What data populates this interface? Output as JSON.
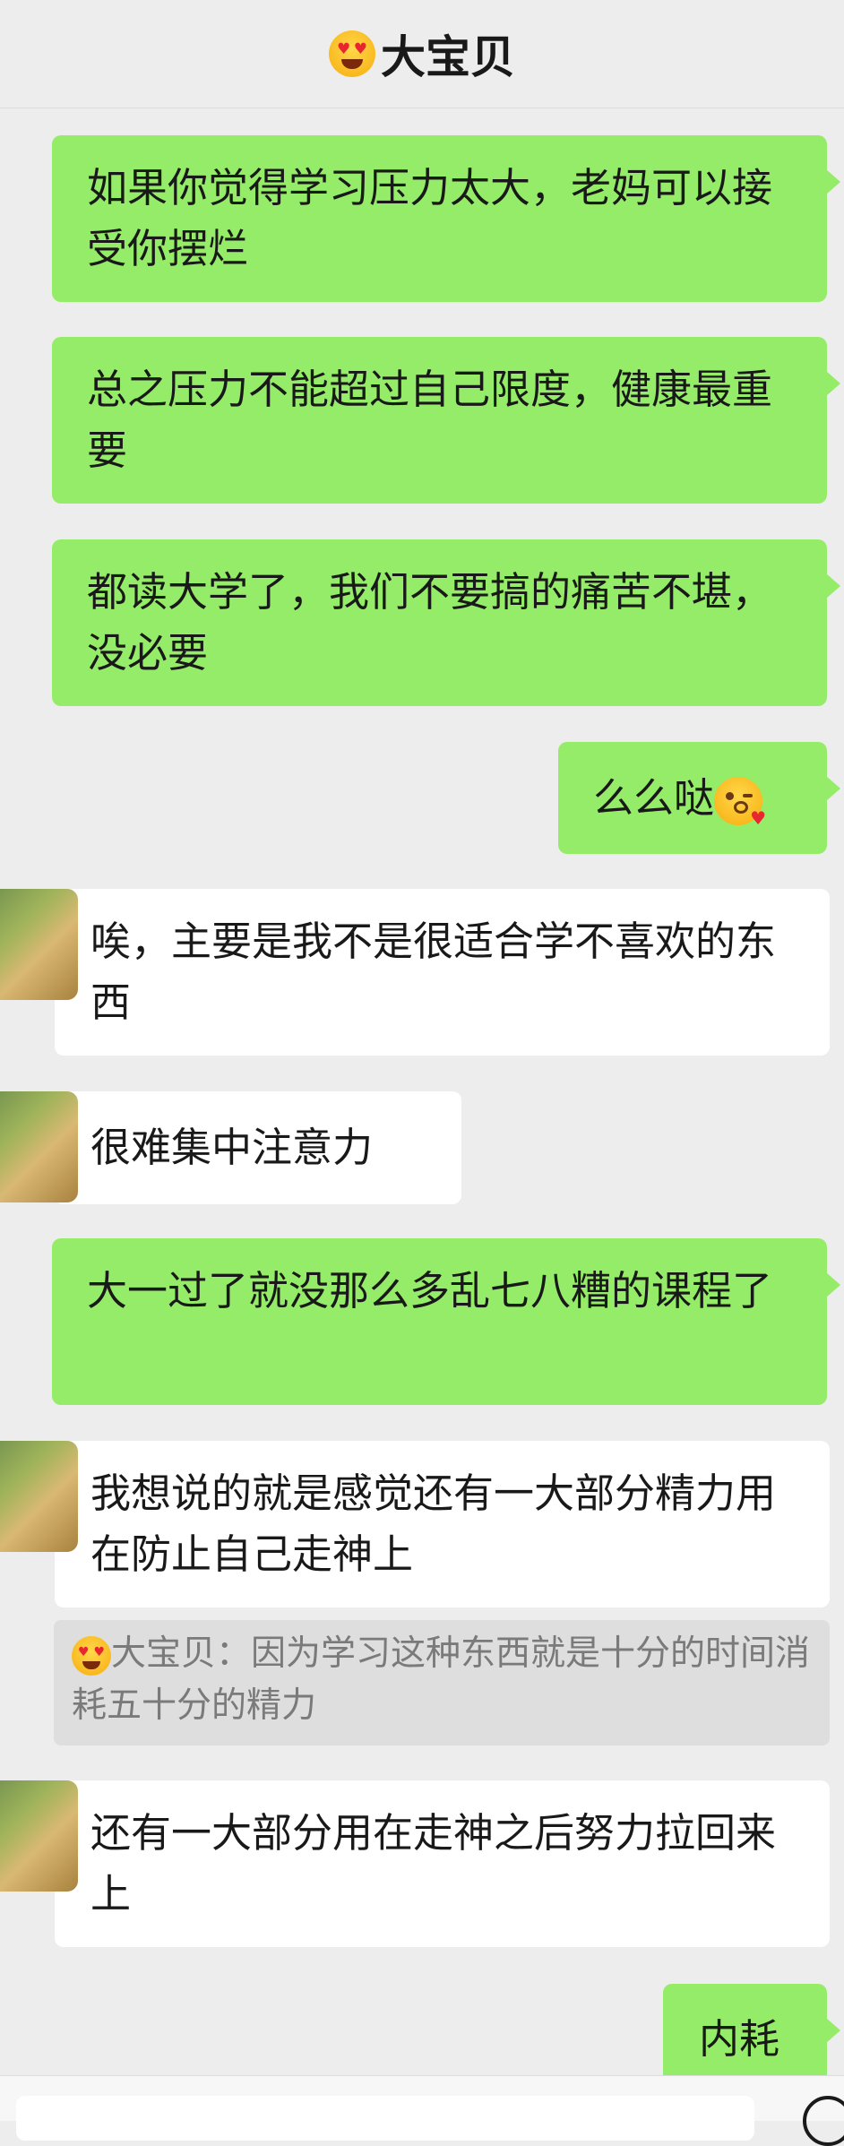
{
  "header": {
    "title": "大宝贝",
    "title_emoji": "smiling-face-with-heart-eyes"
  },
  "messages": [
    {
      "side": "out",
      "text": "如果你觉得学习压力太大，老妈可以接受你摆烂"
    },
    {
      "side": "out",
      "text": "总之压力不能超过自己限度，健康最重要"
    },
    {
      "side": "out",
      "text": "都读大学了，我们不要搞的痛苦不堪，没必要"
    },
    {
      "side": "out",
      "text": "么么哒",
      "emoji": "face-blowing-a-kiss"
    },
    {
      "side": "in",
      "text": "唉，主要是我不是很适合学不喜欢的东西"
    },
    {
      "side": "in",
      "text": "很难集中注意力"
    },
    {
      "side": "out",
      "text": "大一过了就没那么多乱七八糟的课程了"
    },
    {
      "side": "in",
      "text": "我想说的就是感觉还有一大部分精力用在防止自己走神上"
    },
    {
      "side": "in",
      "text": "还有一大部分用在走神之后努力拉回来上"
    },
    {
      "side": "out",
      "text": "内耗"
    }
  ],
  "quote": {
    "sender": "大宝贝",
    "text": "：因为学习这种东西就是十分的时间消耗五十分的精力"
  },
  "colors": {
    "outgoing": "#95ec69",
    "incoming": "#ffffff",
    "background": "#ededed"
  }
}
